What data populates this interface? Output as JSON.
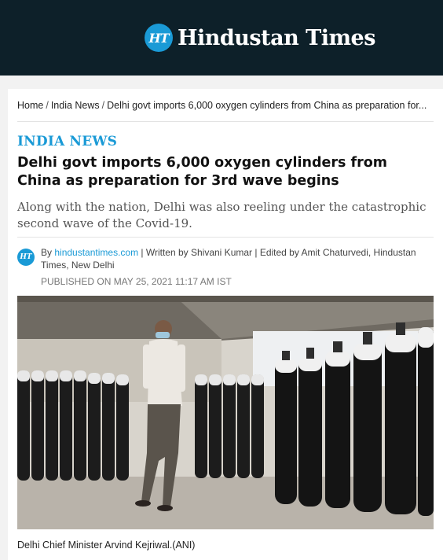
{
  "header": {
    "logo_mark": "HT",
    "brand": "Hindustan Times"
  },
  "breadcrumb": {
    "items": [
      "Home",
      "India News",
      "Delhi govt imports 6,000 oxygen cylinders from China as preparation for..."
    ],
    "separator": "/"
  },
  "article": {
    "section": "INDIA NEWS",
    "headline": "Delhi govt imports 6,000 oxygen cylinders from China as preparation for 3rd wave begins",
    "summary": "Along with the nation, Delhi was also reeling under the catastrophic second wave of the Covid-19.",
    "byline": {
      "avatar": "HT",
      "prefix": "By",
      "source": "hindustantimes.com",
      "rest": " | Written by Shivani Kumar | Edited by Amit Chaturvedi, Hindustan Times, New Delhi"
    },
    "published": "PUBLISHED ON MAY 25, 2021 11:17 AM IST",
    "image_caption": "Delhi Chief Minister Arvind Kejriwal.(ANI)"
  },
  "colors": {
    "header_bg": "#0d2029",
    "accent": "#1a9ad6"
  }
}
